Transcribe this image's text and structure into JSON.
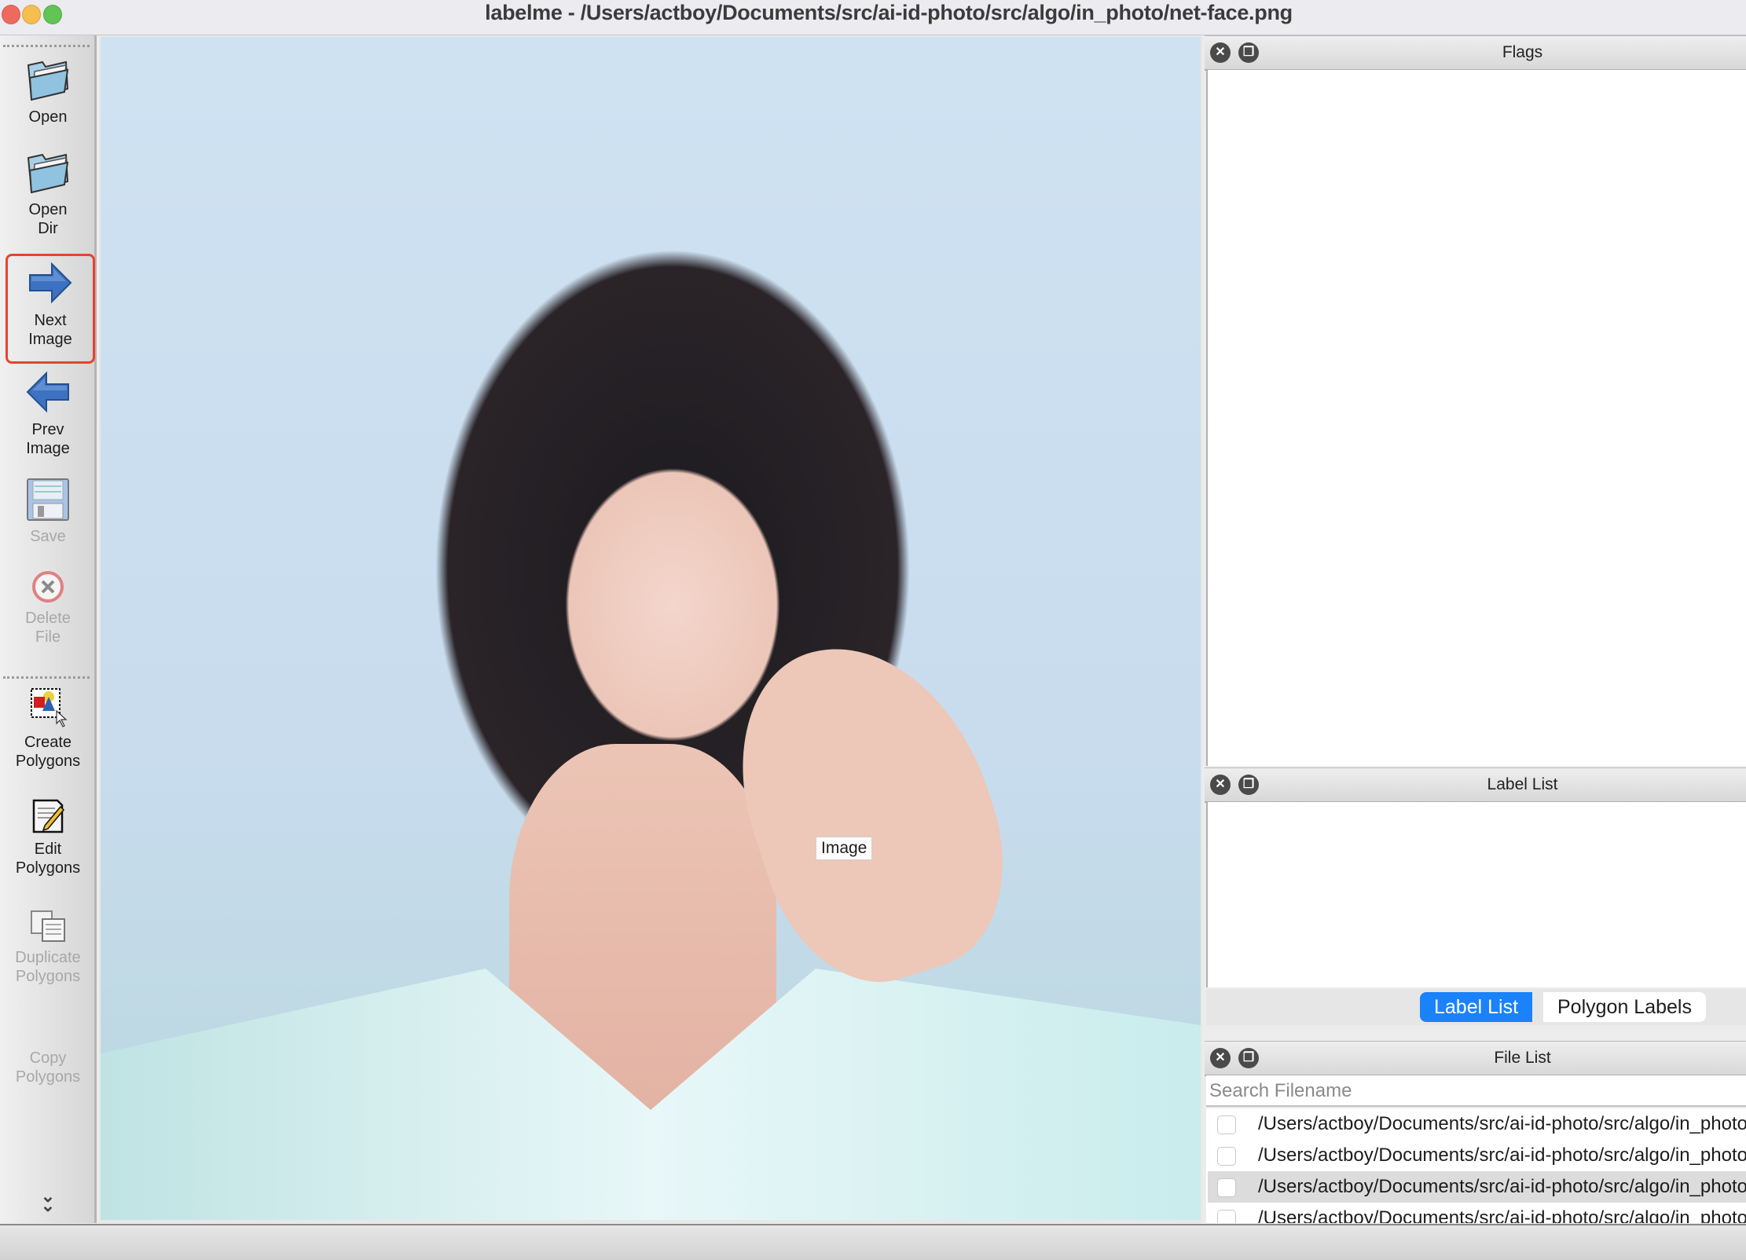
{
  "window": {
    "title": "labelme - /Users/actboy/Documents/src/ai-id-photo/src/algo/in_photo/net-face.png"
  },
  "toolbar": {
    "items": [
      {
        "label_line1": "Open",
        "label_line2": "",
        "icon": "folder-open-icon",
        "enabled": true
      },
      {
        "label_line1": "Open",
        "label_line2": "Dir",
        "icon": "folder-open-icon",
        "enabled": true
      },
      {
        "label_line1": "Next",
        "label_line2": "Image",
        "icon": "arrow-right-icon",
        "enabled": true,
        "highlighted": true
      },
      {
        "label_line1": "Prev",
        "label_line2": "Image",
        "icon": "arrow-left-icon",
        "enabled": true
      },
      {
        "label_line1": "Save",
        "label_line2": "",
        "icon": "floppy-disk-icon",
        "enabled": false
      },
      {
        "label_line1": "Delete",
        "label_line2": "File",
        "icon": "delete-circle-icon",
        "enabled": false
      },
      {
        "label_line1": "Create",
        "label_line2": "Polygons",
        "icon": "create-polygon-icon",
        "enabled": true
      },
      {
        "label_line1": "Edit",
        "label_line2": "Polygons",
        "icon": "edit-pencil-icon",
        "enabled": true
      },
      {
        "label_line1": "Duplicate",
        "label_line2": "Polygons",
        "icon": "duplicate-icon",
        "enabled": false
      },
      {
        "label_line1": "Copy",
        "label_line2": "Polygons",
        "icon": "copy-icon",
        "enabled": false
      }
    ],
    "more_icon": "double-chevron-down-icon"
  },
  "canvas": {
    "tooltip": "Image"
  },
  "docks": {
    "flags": {
      "title": "Flags"
    },
    "label_list": {
      "title": "Label List"
    },
    "tabs": [
      {
        "label": "Label List",
        "active": true
      },
      {
        "label": "Polygon Labels",
        "active": false
      }
    ],
    "file_list": {
      "title": "File List",
      "search_placeholder": "Search Filename",
      "files": [
        {
          "path": "/Users/actboy/Documents/src/ai-id-photo/src/algo/in_photo/",
          "checked": false,
          "selected": false
        },
        {
          "path": "/Users/actboy/Documents/src/ai-id-photo/src/algo/in_photo/",
          "checked": false,
          "selected": false
        },
        {
          "path": "/Users/actboy/Documents/src/ai-id-photo/src/algo/in_photo/",
          "checked": false,
          "selected": true
        },
        {
          "path": "/Users/actboy/Documents/src/ai-id-photo/src/algo/in_photo/",
          "checked": false,
          "selected": false
        }
      ]
    },
    "close_glyph": "✕",
    "float_glyph": "❐"
  },
  "colors": {
    "highlight": "#e8432e",
    "tab_active": "#1a82fb"
  }
}
